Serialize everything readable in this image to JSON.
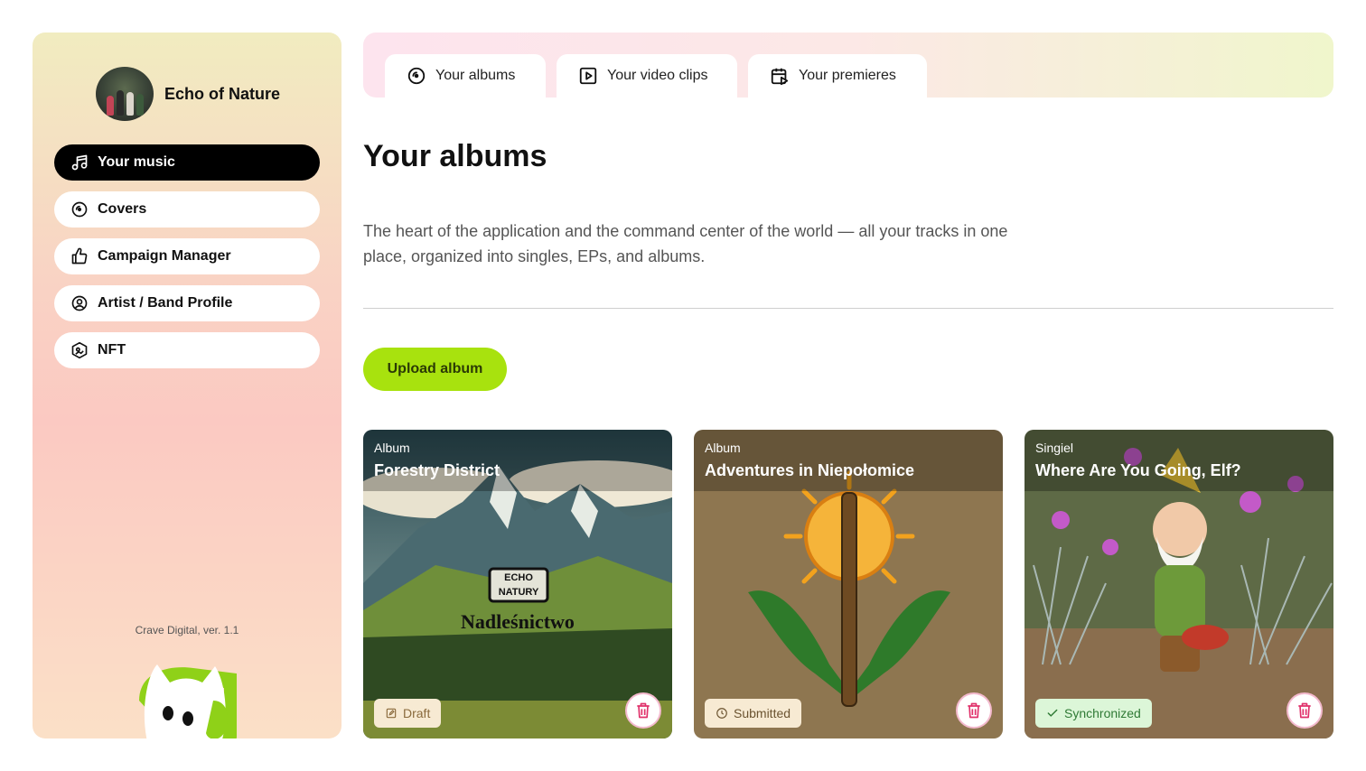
{
  "sidebar": {
    "artist_name": "Echo of Nature",
    "items": [
      {
        "label": "Your music",
        "icon": "music-note-icon",
        "active": true
      },
      {
        "label": "Covers",
        "icon": "disc-icon",
        "active": false
      },
      {
        "label": "Campaign Manager",
        "icon": "thumbs-up-icon",
        "active": false
      },
      {
        "label": "Artist / Band Profile",
        "icon": "user-circle-icon",
        "active": false
      },
      {
        "label": "NFT",
        "icon": "nft-hexagon-icon",
        "active": false
      }
    ],
    "version": "Crave Digital, ver. 1.1"
  },
  "tabs": [
    {
      "label": "Your albums",
      "icon": "disc-icon"
    },
    {
      "label": "Your video clips",
      "icon": "play-square-icon"
    },
    {
      "label": "Your premieres",
      "icon": "calendar-play-icon"
    }
  ],
  "main": {
    "title": "Your albums",
    "description": "The heart of the application and the command center of the world — all your tracks in one place, organized into singles, EPs, and albums.",
    "upload_label": "Upload album"
  },
  "cards": [
    {
      "kind": "Album",
      "title": "Forestry District",
      "status": "Draft",
      "cover_text_1": "ECHO NATURY",
      "cover_text_2": "Nadleśnictwo"
    },
    {
      "kind": "Album",
      "title": "Adventures in Niepołomice",
      "status": "Submitted"
    },
    {
      "kind": "Singiel",
      "title": "Where Are You Going, Elf?",
      "status": "Synchronized"
    }
  ],
  "colors": {
    "accent": "#a8e20e",
    "trash": "#e0306a"
  }
}
